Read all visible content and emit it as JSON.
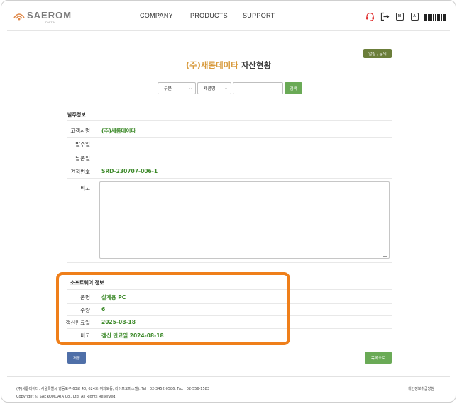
{
  "header": {
    "logo_text": "SAEROM",
    "logo_sub": "DATA",
    "nav": [
      "COMPANY",
      "PRODUCTS",
      "SUPPORT"
    ],
    "icons": [
      "headset-icon",
      "logout-icon",
      "m-box-icon",
      "a-box-icon",
      "barcode-icon"
    ],
    "icon_letters": {
      "m": "M",
      "a": "A"
    },
    "accent_color": "#e03030"
  },
  "notice_button": "알림 / 문의",
  "title": {
    "company": "(주)새롬데이타",
    "suffix": " 자산현황"
  },
  "search": {
    "category_select": "구분",
    "product_select": "제품명",
    "keyword_value": "",
    "button": "검색"
  },
  "order_info": {
    "section_title": "발주정보",
    "fields": [
      {
        "label": "고객사명",
        "value": "(주)새롬데이타"
      },
      {
        "label": "발주일",
        "value": ""
      },
      {
        "label": "납품일",
        "value": ""
      },
      {
        "label": "견적번호",
        "value": "SRD-230707-006-1"
      }
    ],
    "memo_label": "비고",
    "memo_value": ""
  },
  "software_info": {
    "section_title": "소프트웨어 정보",
    "fields": [
      {
        "label": "품명",
        "value": "설계용 PC"
      },
      {
        "label": "수량",
        "value": "6"
      },
      {
        "label": "갱신만료일",
        "value": "2025-08-18"
      },
      {
        "label": "비고",
        "value": "갱신 만료일 2024-08-18"
      }
    ]
  },
  "buttons": {
    "save": "저장",
    "list": "목록으로"
  },
  "footer": {
    "address": "(주)새롬데이타.  서울특별시 영등포구 63로 40, 624호(여의도동, 라이프오피스텔). Tel : 02-3452-0586.  Fax : 02-556-1583",
    "copyright": "Copyright © SAEROMDATA Co., Ltd. All Rights Reserved.",
    "privacy": "개인정보취급방침"
  },
  "colors": {
    "green": "#3d8a2a",
    "orange_highlight": "#ef7f1a",
    "brand_orange": "#d89a3c",
    "button_green": "#6aaa56",
    "save_blue": "#4f6fa8"
  }
}
